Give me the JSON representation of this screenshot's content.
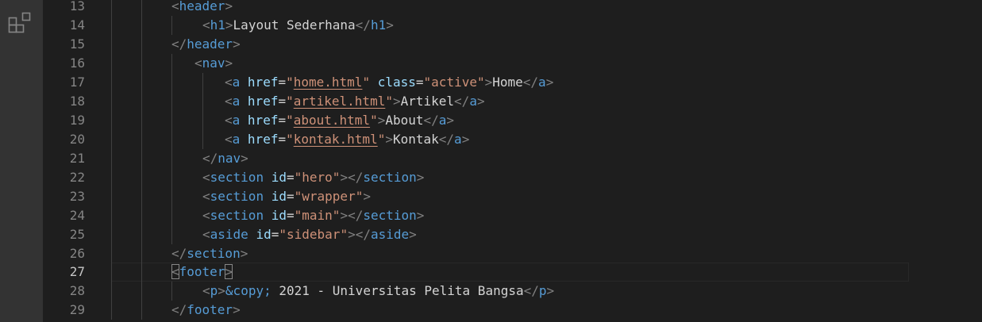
{
  "activity_bar": {
    "icon": "extensions-icon"
  },
  "editor": {
    "current_line": 27,
    "lines": [
      {
        "num": "13",
        "text": "<header>"
      },
      {
        "num": "14",
        "text": "<h1>Layout Sederhana</h1>"
      },
      {
        "num": "15",
        "text": "</header>"
      },
      {
        "num": "16",
        "text": "<nav>"
      },
      {
        "num": "17",
        "text": "<a href=\"home.html\" class=\"active\">Home</a>"
      },
      {
        "num": "18",
        "text": "<a href=\"artikel.html\">Artikel</a>"
      },
      {
        "num": "19",
        "text": "<a href=\"about.html\">About</a>"
      },
      {
        "num": "20",
        "text": "<a href=\"kontak.html\">Kontak</a>"
      },
      {
        "num": "21",
        "text": "</nav>"
      },
      {
        "num": "22",
        "text": "<section id=\"hero\"></section>"
      },
      {
        "num": "23",
        "text": "<section id=\"wrapper\">"
      },
      {
        "num": "24",
        "text": "<section id=\"main\"></section>"
      },
      {
        "num": "25",
        "text": "<aside id=\"sidebar\"></aside>"
      },
      {
        "num": "26",
        "text": "</section>"
      },
      {
        "num": "27",
        "text": "<footer>"
      },
      {
        "num": "28",
        "text": "<p>&copy; 2021 - Universitas Pelita Bangsa</p>"
      },
      {
        "num": "29",
        "text": "</footer>"
      }
    ]
  },
  "tokens": {
    "lt": "<",
    "lts": "</",
    "gt": ">",
    "eq": "=",
    "sp": " ",
    "header": "header",
    "h1": "h1",
    "title_text": "Layout Sederhana",
    "nav": "nav",
    "a": "a",
    "href": "href",
    "class": "class",
    "q": "\"",
    "home_html": "home.html",
    "active": "active",
    "home": "Home",
    "artikel_html": "artikel.html",
    "artikel": "Artikel",
    "about_html": "about.html",
    "about": "About",
    "kontak_html": "kontak.html",
    "kontak": "Kontak",
    "section": "section",
    "id": "id",
    "hero": "hero",
    "wrapper": "wrapper",
    "main": "main",
    "aside": "aside",
    "sidebar": "sidebar",
    "footer": "footer",
    "p": "p",
    "copy": "&copy;",
    "footer_text": " 2021 - Universitas Pelita Bangsa"
  }
}
